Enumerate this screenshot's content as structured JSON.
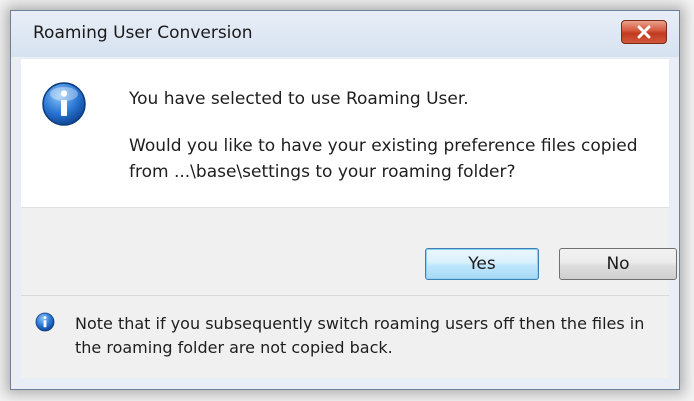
{
  "window": {
    "title": "Roaming User Conversion"
  },
  "dialog": {
    "message_line1": "You have selected to use Roaming User.",
    "message_line2": "Would you like to have your existing preference files copied from ...\\base\\settings to your roaming folder?",
    "icon": "info-icon"
  },
  "buttons": {
    "yes_label": "Yes",
    "no_label": "No"
  },
  "footer": {
    "note": "Note that if you subsequently switch roaming users off then the files in the roaming folder are not copied back.",
    "icon": "info-icon"
  },
  "colors": {
    "close_button": "#c8442a",
    "default_button": "#bee6fd",
    "info_icon": "#1f63b8"
  }
}
